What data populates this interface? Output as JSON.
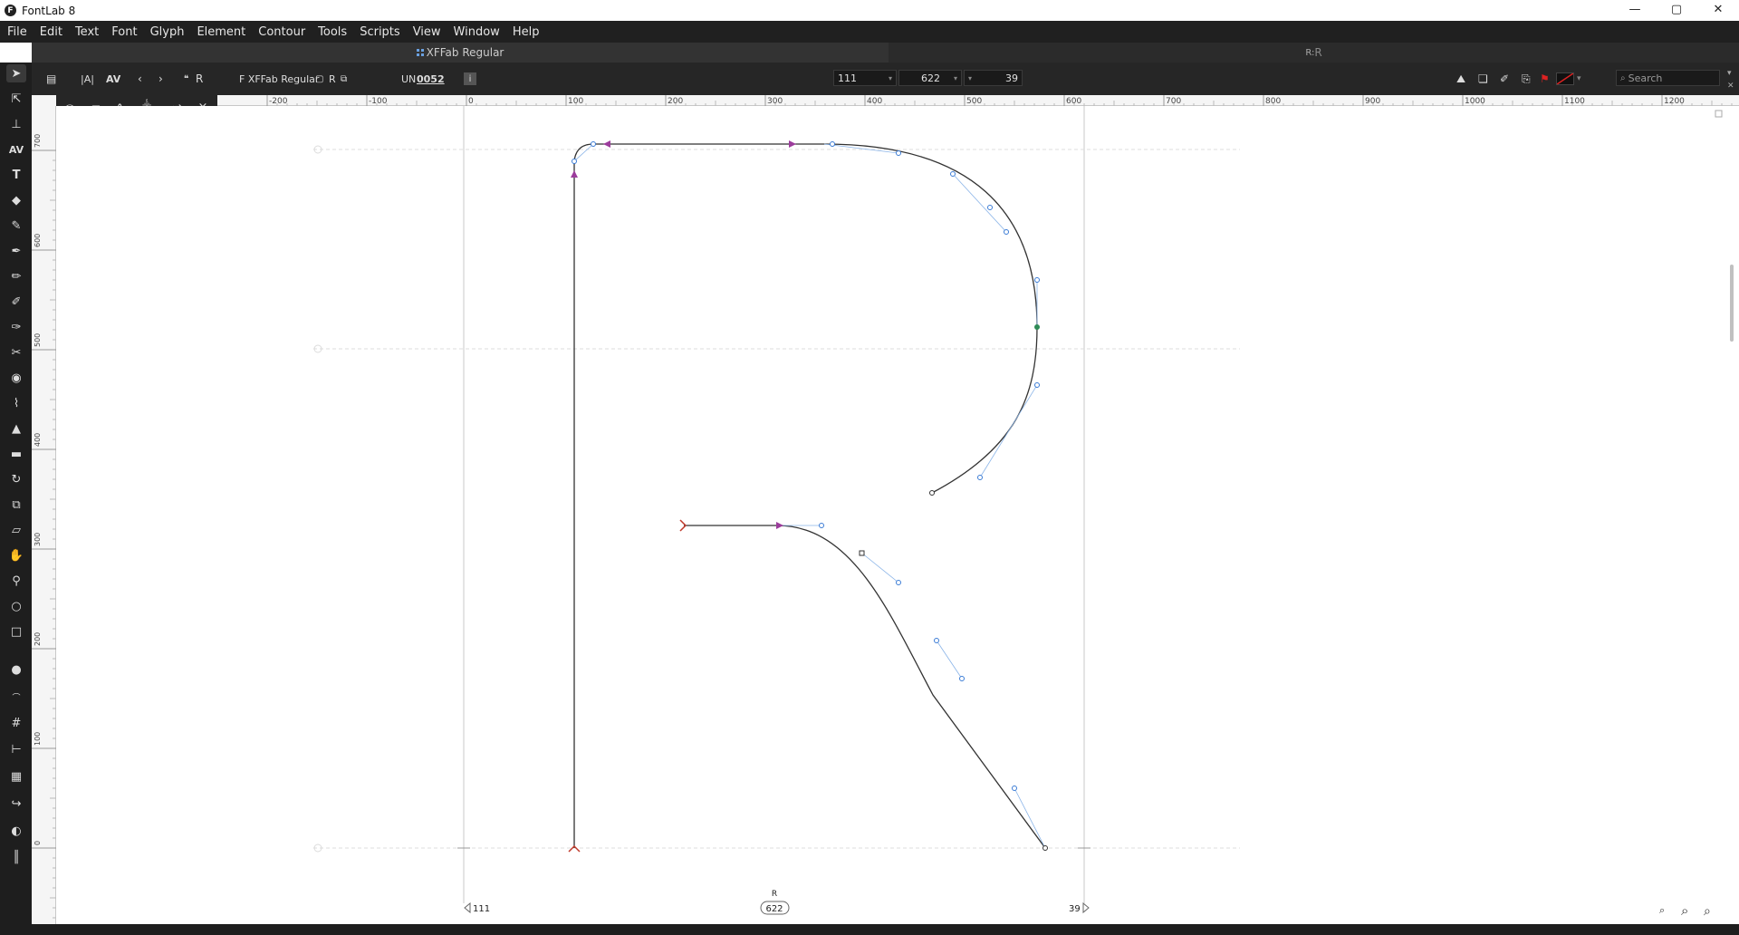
{
  "window": {
    "title": "FontLab 8",
    "minimize": "—",
    "maximize": "▢",
    "close": "✕"
  },
  "menu": [
    "File",
    "Edit",
    "Text",
    "Font",
    "Glyph",
    "Element",
    "Contour",
    "Tools",
    "Scripts",
    "View",
    "Window",
    "Help"
  ],
  "tabs": {
    "active": "XFFab Regular",
    "other_prefix": "R:",
    "other_glyph": "R"
  },
  "toolbar": {
    "glyph_nav_label": "R",
    "font_label": "F  XFFab Regular",
    "mark_label": "R",
    "unicode_prefix": "UN",
    "unicode_value": "0052",
    "info_badge": "i",
    "lsb_value": "111",
    "width_value": "622",
    "rsb_value": "39",
    "search_placeholder": "Search"
  },
  "rulers": {
    "top_ticks": [
      "-200",
      "-100",
      "0",
      "100",
      "200",
      "300",
      "400",
      "500",
      "600",
      "700",
      "800",
      "900",
      "1000",
      "1100",
      "1200"
    ],
    "left_ticks": [
      "700",
      "600",
      "500",
      "400",
      "300",
      "200",
      "100",
      "0"
    ]
  },
  "glyph": {
    "name": "R",
    "lsb": "111",
    "advance_width": "622",
    "rsb": "39"
  },
  "colors": {
    "accent": "#4da3ff",
    "node_tangent": "#3a7bd5",
    "direction_arrow": "#9c3c9c",
    "start_node": "#c0392b",
    "smooth_green": "#2e8b57"
  }
}
